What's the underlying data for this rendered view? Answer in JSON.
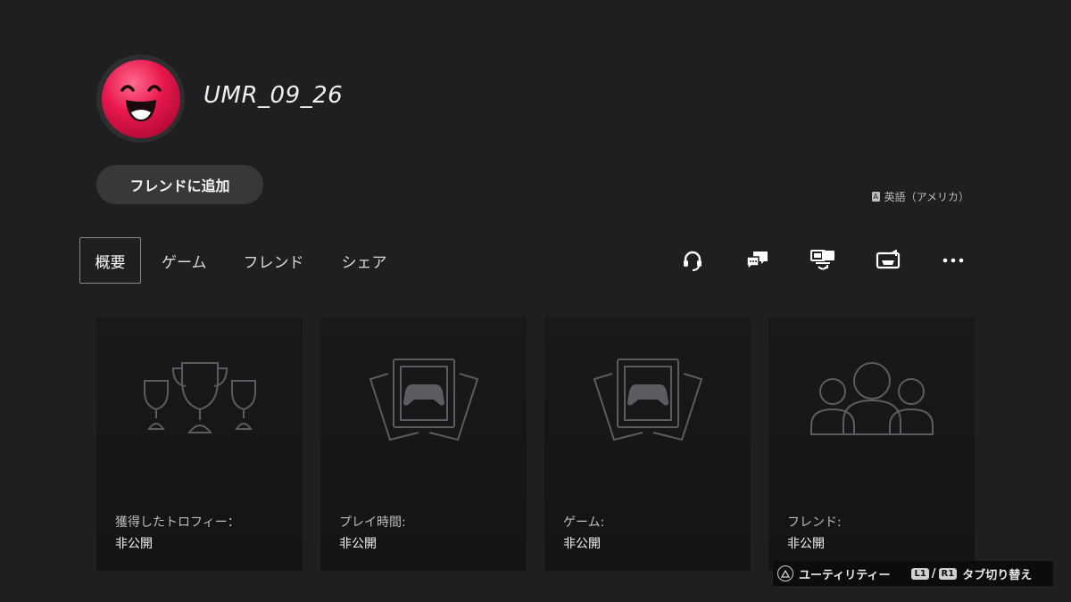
{
  "profile": {
    "username": "UMR_09_26",
    "avatar_icon": "smiley-face-avatar",
    "add_friend_label": "フレンドに追加",
    "language": "英語（アメリカ）",
    "language_icon": "translate-icon"
  },
  "tabs": [
    {
      "label": "概要",
      "selected": true
    },
    {
      "label": "ゲーム",
      "selected": false
    },
    {
      "label": "フレンド",
      "selected": false
    },
    {
      "label": "シェア",
      "selected": false
    }
  ],
  "actions": [
    {
      "icon": "headset-icon"
    },
    {
      "icon": "message-icon"
    },
    {
      "icon": "share-screen-icon"
    },
    {
      "icon": "game-invite-icon"
    },
    {
      "icon": "more-icon"
    }
  ],
  "cards": [
    {
      "icon": "trophy-icon",
      "label": "獲得したトロフィー：",
      "value": "非公開"
    },
    {
      "icon": "game-cards-icon",
      "label": "プレイ時間:",
      "value": "非公開"
    },
    {
      "icon": "game-cards-icon",
      "label": "ゲーム:",
      "value": "非公開"
    },
    {
      "icon": "friends-icon",
      "label": "フレンド:",
      "value": "非公開"
    }
  ],
  "hints": {
    "utility_label": "ユーティリティー",
    "l1": "L1",
    "slash": "/",
    "r1": "R1",
    "switch_tabs_label": "タブ切り替え"
  },
  "colors": {
    "background": "#1f1f21",
    "avatar": "#e8174e",
    "card": "#19191b"
  }
}
